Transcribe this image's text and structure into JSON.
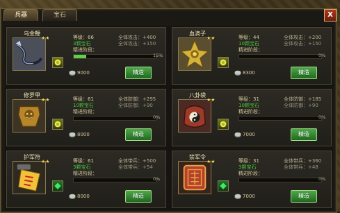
{
  "tabs": [
    {
      "label": "兵器",
      "active": true
    },
    {
      "label": "宝石",
      "active": false
    }
  ],
  "close_label": "X",
  "colors": {
    "accent_green": "#48c53c",
    "button_green": "#3c8f38",
    "close_red": "#b0361f",
    "gold_text": "#d6c89e"
  },
  "cards": [
    {
      "name": "乌金鞭",
      "icon": "whip-icon",
      "level_label": "等级：66",
      "attr1": "全体攻击：+400",
      "gem_info": "3颗宝石",
      "attr2": "全体攻击：+150",
      "stage_label": "精进阶段：",
      "progress": 0.15,
      "pct_text": "15%",
      "stars": "★★",
      "coins": "9000",
      "button": "精造"
    },
    {
      "name": "血滴子",
      "icon": "bloodhound-blade-icon",
      "level_label": "等级：44",
      "attr1": "全体攻击：+200",
      "gem_info": "10颗宝石",
      "attr2": "全体攻击：+150",
      "stage_label": "精进阶段：",
      "progress": 0.0,
      "pct_text": "0%",
      "stars": "★★",
      "coins": "8300",
      "button": "精造"
    },
    {
      "name": "修罗甲",
      "icon": "armor-icon",
      "level_label": "等级：61",
      "attr1": "全体防御：+295",
      "gem_info": "10颗宝石",
      "attr2": "全体防御：+90",
      "stage_label": "精进阶段：",
      "progress": 0.0,
      "pct_text": "0%",
      "stars": "★★",
      "coins": "8000",
      "button": "精造"
    },
    {
      "name": "八卦袋",
      "icon": "bagua-pouch-icon",
      "level_label": "等级：31",
      "attr1": "全体防御：+185",
      "gem_info": "10颗宝石",
      "attr2": "全体防御：+90",
      "stage_label": "精进阶段：",
      "progress": 0.0,
      "pct_text": "0%",
      "stars": "★★",
      "coins": "7000",
      "button": "精造"
    },
    {
      "name": "护军符",
      "icon": "talisman-icon",
      "level_label": "等级：61",
      "attr1": "全体带兵：+500",
      "gem_info": "3颗宝石",
      "attr2": "全体带兵：+54",
      "stage_label": "精进阶段：",
      "progress": 0.0,
      "pct_text": "0%",
      "stars": "★★",
      "coins": "8000",
      "button": "精造"
    },
    {
      "name": "禁军令",
      "icon": "command-token-icon",
      "level_label": "等级：31",
      "attr1": "全体带兵：+360",
      "gem_info": "3颗宝石",
      "attr2": "全体带兵：+48",
      "stage_label": "精进阶段：",
      "progress": 0.0,
      "pct_text": "0%",
      "stars": "★★",
      "coins": "7000",
      "button": "精造"
    }
  ]
}
